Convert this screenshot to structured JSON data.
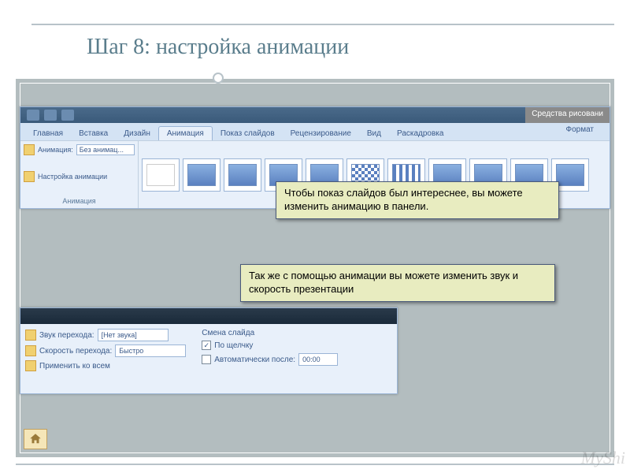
{
  "title": "Шаг 8: настройка анимации",
  "ribbon": {
    "tabs": [
      "Главная",
      "Вставка",
      "Дизайн",
      "Анимация",
      "Показ слайдов",
      "Рецензирование",
      "Вид",
      "Раскадровка"
    ],
    "active_tab": "Анимация",
    "context_title": "Средства рисовани",
    "format_tab": "Формат",
    "group": {
      "anim_label": "Анимация:",
      "anim_value": "Без анимац...",
      "custom": "Настройка анимации",
      "name": "Анимация"
    }
  },
  "callout1": "Чтобы показ слайдов был интереснее, вы можете изменить анимацию в панели.",
  "callout2": "Так же с помощью анимации вы можете изменить звук и скорость презентации",
  "settings": {
    "sound_label": "Звук перехода:",
    "sound_value": "[Нет звука]",
    "speed_label": "Скорость перехода:",
    "speed_value": "Быстро",
    "apply_all": "Применить ко всем",
    "change_title": "Смена слайда",
    "on_click": "По щелчку",
    "auto_after": "Автоматически после:",
    "time": "00:00"
  },
  "watermark": "MyShi"
}
